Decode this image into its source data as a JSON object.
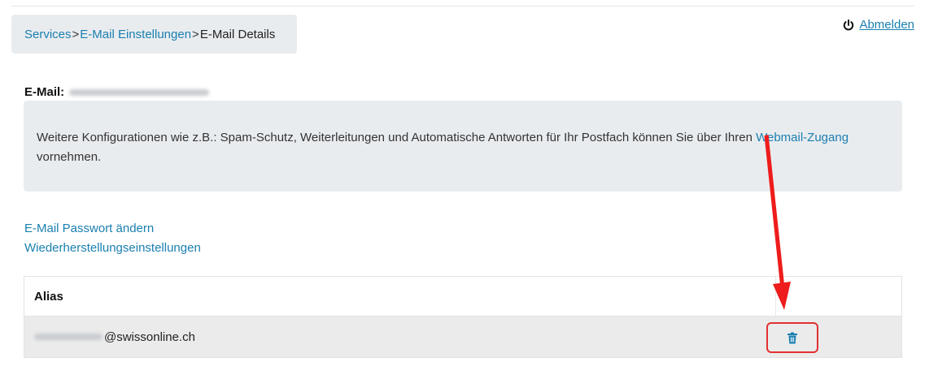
{
  "breadcrumb": {
    "items": [
      "Services",
      "E-Mail Einstellungen"
    ],
    "separator": ">",
    "current": "E-Mail Details"
  },
  "logout": {
    "label": "Abmelden",
    "icon": "power-icon"
  },
  "email": {
    "label": "E-Mail:"
  },
  "info": {
    "text": "Weitere Konfigurationen wie z.B.: Spam-Schutz, Weiterleitungen und Automatische Antworten für Ihr Postfach können Sie über Ihren ",
    "link": "Webmail-Zugang",
    "suffix": " vornehmen."
  },
  "links": {
    "change_password": "E-Mail Passwort ändern",
    "recovery": "Wiederherstellungseinstellungen"
  },
  "alias_table": {
    "header": "Alias",
    "rows": [
      {
        "domain": "@swissonline.ch",
        "delete_icon": "trash-icon"
      }
    ]
  },
  "colors": {
    "link": "#1a7fb0",
    "highlight": "#e23030",
    "box_bg": "#e9ecef"
  }
}
